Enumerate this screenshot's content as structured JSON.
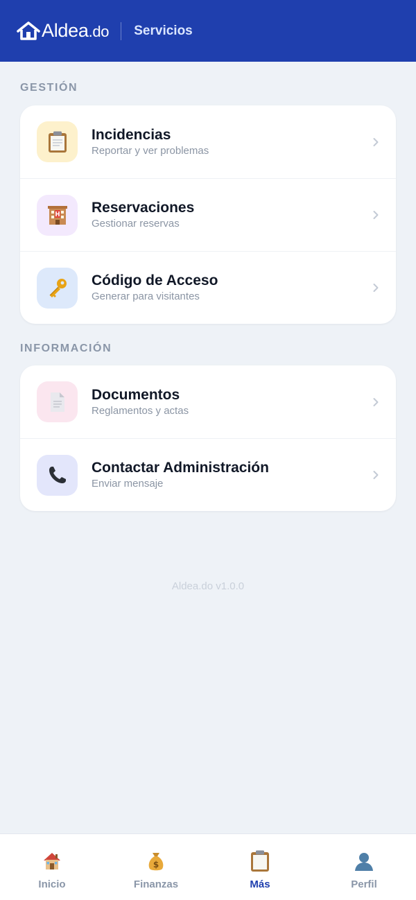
{
  "header": {
    "brand_main": "Aldea",
    "brand_suffix": ".do",
    "title": "Servicios"
  },
  "sections": [
    {
      "label": "GESTIÓN",
      "items": [
        {
          "title": "Incidencias",
          "subtitle": "Reportar y ver problemas",
          "icon": "clipboard-icon",
          "tile_color": "#fdf1cc"
        },
        {
          "title": "Reservaciones",
          "subtitle": "Gestionar reservas",
          "icon": "hotel-icon",
          "tile_color": "#f3e9fd"
        },
        {
          "title": "Código de Acceso",
          "subtitle": "Generar para visitantes",
          "icon": "key-icon",
          "tile_color": "#dde9fb"
        }
      ]
    },
    {
      "label": "INFORMACIÓN",
      "items": [
        {
          "title": "Documentos",
          "subtitle": "Reglamentos y actas",
          "icon": "document-icon",
          "tile_color": "#fbe6ef"
        },
        {
          "title": "Contactar Administración",
          "subtitle": "Enviar mensaje",
          "icon": "phone-icon",
          "tile_color": "#e3e6fb"
        }
      ]
    }
  ],
  "footer": {
    "version": "Aldea.do v1.0.0"
  },
  "bottom_nav": [
    {
      "label": "Inicio",
      "icon": "house-icon",
      "active": false
    },
    {
      "label": "Finanzas",
      "icon": "money-bag-icon",
      "active": false
    },
    {
      "label": "Más",
      "icon": "clipboard-icon",
      "active": true
    },
    {
      "label": "Perfil",
      "icon": "user-icon",
      "active": false
    }
  ],
  "colors": {
    "header_bg": "#1f3fae",
    "page_bg": "#eef2f7",
    "active_nav": "#1f3fae",
    "muted": "#8a96a8"
  }
}
